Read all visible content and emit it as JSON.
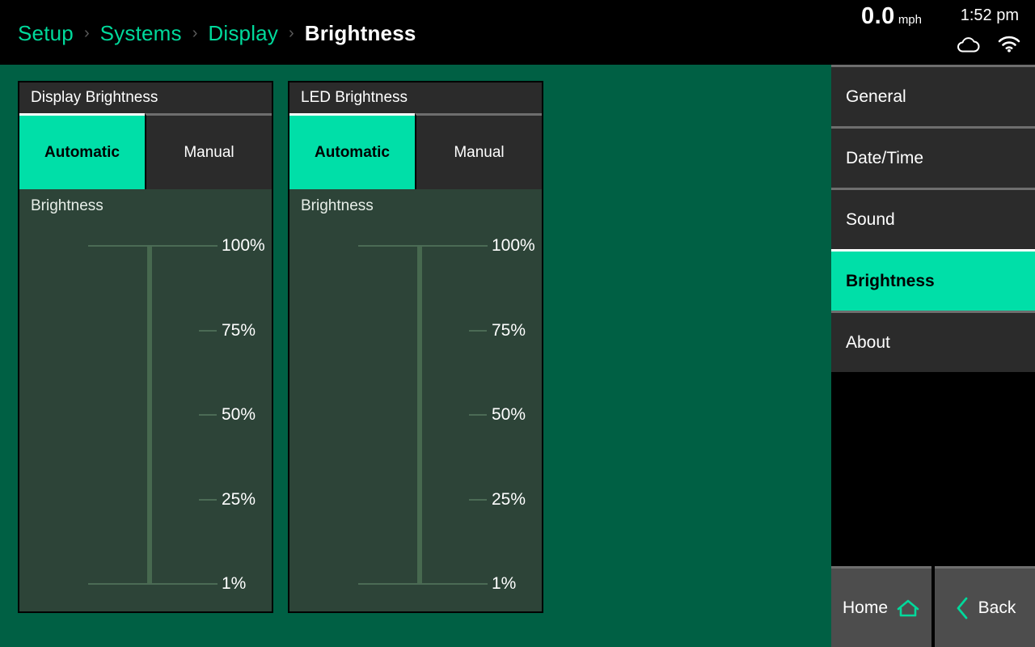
{
  "header": {
    "breadcrumb": [
      {
        "label": "Setup",
        "active": false
      },
      {
        "label": "Systems",
        "active": false
      },
      {
        "label": "Display",
        "active": false
      },
      {
        "label": "Brightness",
        "active": true
      }
    ],
    "separator": "›",
    "status": {
      "speed_value": "0.0",
      "speed_unit": "mph",
      "time": "1:52 pm",
      "icons": [
        "cloud-icon",
        "wifi-icon"
      ]
    }
  },
  "panels": [
    {
      "title": "Display Brightness",
      "tabs": [
        {
          "label": "Automatic",
          "active": true
        },
        {
          "label": "Manual",
          "active": false
        }
      ],
      "body_label": "Brightness",
      "slider": {
        "ticks": [
          {
            "label": "100%",
            "kind": "long",
            "pos": 0
          },
          {
            "label": "75%",
            "kind": "short",
            "pos": 25
          },
          {
            "label": "50%",
            "kind": "short",
            "pos": 50
          },
          {
            "label": "25%",
            "kind": "short",
            "pos": 75
          },
          {
            "label": "1%",
            "kind": "long",
            "pos": 100
          }
        ]
      }
    },
    {
      "title": "LED Brightness",
      "tabs": [
        {
          "label": "Automatic",
          "active": true
        },
        {
          "label": "Manual",
          "active": false
        }
      ],
      "body_label": "Brightness",
      "slider": {
        "ticks": [
          {
            "label": "100%",
            "kind": "long",
            "pos": 0
          },
          {
            "label": "75%",
            "kind": "short",
            "pos": 25
          },
          {
            "label": "50%",
            "kind": "short",
            "pos": 50
          },
          {
            "label": "25%",
            "kind": "short",
            "pos": 75
          },
          {
            "label": "1%",
            "kind": "long",
            "pos": 100
          }
        ]
      }
    }
  ],
  "sidebar": {
    "items": [
      {
        "label": "General",
        "active": false
      },
      {
        "label": "Date/Time",
        "active": false
      },
      {
        "label": "Sound",
        "active": false
      },
      {
        "label": "Brightness",
        "active": true
      },
      {
        "label": "About",
        "active": false
      }
    ],
    "nav": [
      {
        "label": "Home",
        "icon": "home-icon",
        "icon_side": "right"
      },
      {
        "label": "Back",
        "icon": "chevron-left-icon",
        "icon_side": "left"
      }
    ]
  },
  "colors": {
    "background": "#00604a",
    "accent": "#00dfa8",
    "panel": "#2d4438",
    "chrome": "#2b2b2b",
    "border": "#6e6e6e",
    "text": "#ffffff"
  }
}
